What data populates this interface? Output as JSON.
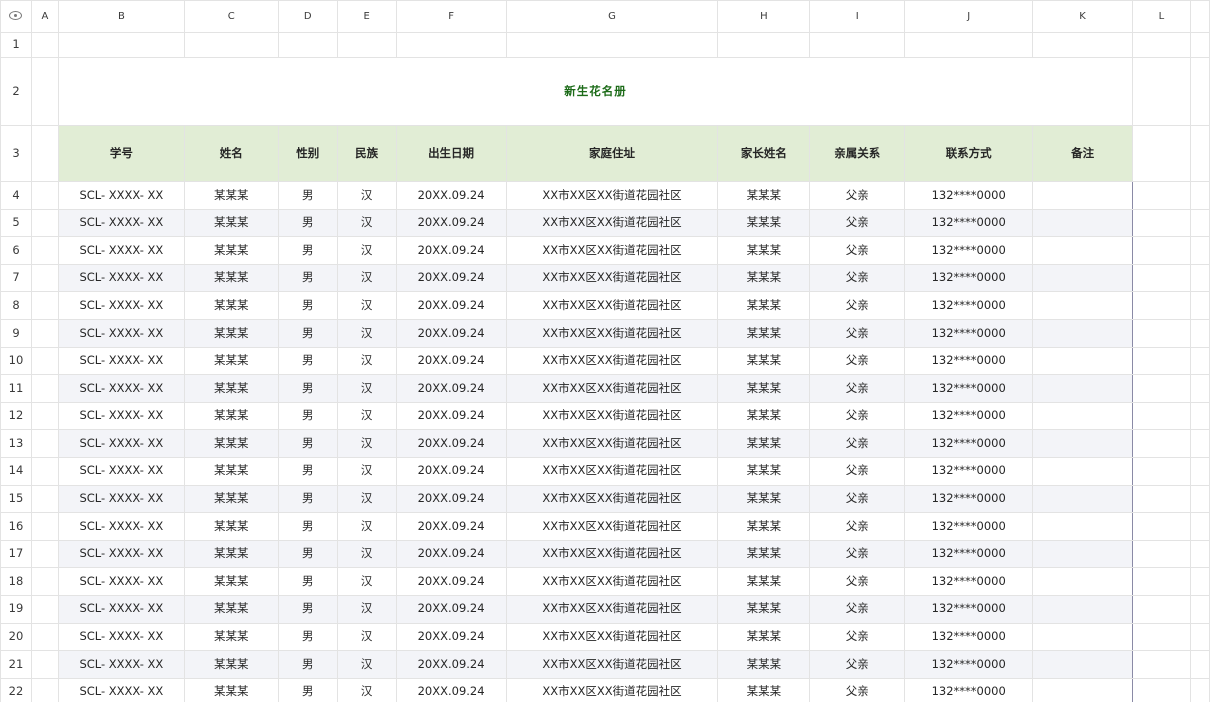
{
  "sheet": {
    "columns": [
      "A",
      "B",
      "C",
      "D",
      "E",
      "F",
      "G",
      "H",
      "I",
      "J",
      "K",
      "L"
    ],
    "title": "新生花名册",
    "headers": [
      "学号",
      "姓名",
      "性别",
      "民族",
      "出生日期",
      "家庭住址",
      "家长姓名",
      "亲属关系",
      "联系方式",
      "备注"
    ],
    "rows": [
      {
        "num": "4",
        "cells": [
          "SCL- XXXX- XX",
          "某某某",
          "男",
          "汉",
          "20XX.09.24",
          "XX市XX区XX街道花园社区",
          "某某某",
          "父亲",
          "132****0000",
          ""
        ]
      },
      {
        "num": "5",
        "cells": [
          "SCL- XXXX- XX",
          "某某某",
          "男",
          "汉",
          "20XX.09.24",
          "XX市XX区XX街道花园社区",
          "某某某",
          "父亲",
          "132****0000",
          ""
        ]
      },
      {
        "num": "6",
        "cells": [
          "SCL- XXXX- XX",
          "某某某",
          "男",
          "汉",
          "20XX.09.24",
          "XX市XX区XX街道花园社区",
          "某某某",
          "父亲",
          "132****0000",
          ""
        ]
      },
      {
        "num": "7",
        "cells": [
          "SCL- XXXX- XX",
          "某某某",
          "男",
          "汉",
          "20XX.09.24",
          "XX市XX区XX街道花园社区",
          "某某某",
          "父亲",
          "132****0000",
          ""
        ]
      },
      {
        "num": "8",
        "cells": [
          "SCL- XXXX- XX",
          "某某某",
          "男",
          "汉",
          "20XX.09.24",
          "XX市XX区XX街道花园社区",
          "某某某",
          "父亲",
          "132****0000",
          ""
        ]
      },
      {
        "num": "9",
        "cells": [
          "SCL- XXXX- XX",
          "某某某",
          "男",
          "汉",
          "20XX.09.24",
          "XX市XX区XX街道花园社区",
          "某某某",
          "父亲",
          "132****0000",
          ""
        ]
      },
      {
        "num": "10",
        "cells": [
          "SCL- XXXX- XX",
          "某某某",
          "男",
          "汉",
          "20XX.09.24",
          "XX市XX区XX街道花园社区",
          "某某某",
          "父亲",
          "132****0000",
          ""
        ]
      },
      {
        "num": "11",
        "cells": [
          "SCL- XXXX- XX",
          "某某某",
          "男",
          "汉",
          "20XX.09.24",
          "XX市XX区XX街道花园社区",
          "某某某",
          "父亲",
          "132****0000",
          ""
        ]
      },
      {
        "num": "12",
        "cells": [
          "SCL- XXXX- XX",
          "某某某",
          "男",
          "汉",
          "20XX.09.24",
          "XX市XX区XX街道花园社区",
          "某某某",
          "父亲",
          "132****0000",
          ""
        ]
      },
      {
        "num": "13",
        "cells": [
          "SCL- XXXX- XX",
          "某某某",
          "男",
          "汉",
          "20XX.09.24",
          "XX市XX区XX街道花园社区",
          "某某某",
          "父亲",
          "132****0000",
          ""
        ]
      },
      {
        "num": "14",
        "cells": [
          "SCL- XXXX- XX",
          "某某某",
          "男",
          "汉",
          "20XX.09.24",
          "XX市XX区XX街道花园社区",
          "某某某",
          "父亲",
          "132****0000",
          ""
        ]
      },
      {
        "num": "15",
        "cells": [
          "SCL- XXXX- XX",
          "某某某",
          "男",
          "汉",
          "20XX.09.24",
          "XX市XX区XX街道花园社区",
          "某某某",
          "父亲",
          "132****0000",
          ""
        ]
      },
      {
        "num": "16",
        "cells": [
          "SCL- XXXX- XX",
          "某某某",
          "男",
          "汉",
          "20XX.09.24",
          "XX市XX区XX街道花园社区",
          "某某某",
          "父亲",
          "132****0000",
          ""
        ]
      },
      {
        "num": "17",
        "cells": [
          "SCL- XXXX- XX",
          "某某某",
          "男",
          "汉",
          "20XX.09.24",
          "XX市XX区XX街道花园社区",
          "某某某",
          "父亲",
          "132****0000",
          ""
        ]
      },
      {
        "num": "18",
        "cells": [
          "SCL- XXXX- XX",
          "某某某",
          "男",
          "汉",
          "20XX.09.24",
          "XX市XX区XX街道花园社区",
          "某某某",
          "父亲",
          "132****0000",
          ""
        ]
      },
      {
        "num": "19",
        "cells": [
          "SCL- XXXX- XX",
          "某某某",
          "男",
          "汉",
          "20XX.09.24",
          "XX市XX区XX街道花园社区",
          "某某某",
          "父亲",
          "132****0000",
          ""
        ]
      },
      {
        "num": "20",
        "cells": [
          "SCL- XXXX- XX",
          "某某某",
          "男",
          "汉",
          "20XX.09.24",
          "XX市XX区XX街道花园社区",
          "某某某",
          "父亲",
          "132****0000",
          ""
        ]
      },
      {
        "num": "21",
        "cells": [
          "SCL- XXXX- XX",
          "某某某",
          "男",
          "汉",
          "20XX.09.24",
          "XX市XX区XX街道花园社区",
          "某某某",
          "父亲",
          "132****0000",
          ""
        ]
      },
      {
        "num": "22",
        "cells": [
          "SCL- XXXX- XX",
          "某某某",
          "男",
          "汉",
          "20XX.09.24",
          "XX市XX区XX街道花园社区",
          "某某某",
          "父亲",
          "132****0000",
          ""
        ]
      }
    ],
    "row_labels": {
      "r1": "1",
      "r2": "2",
      "r3": "3"
    },
    "colors": {
      "title": "#1c6b18",
      "header_fill": "#e1edd5",
      "alt_row_fill": "#f3f4f8",
      "table_border": "#8a8aa6"
    },
    "icons": {
      "corner": "eye-icon"
    }
  }
}
